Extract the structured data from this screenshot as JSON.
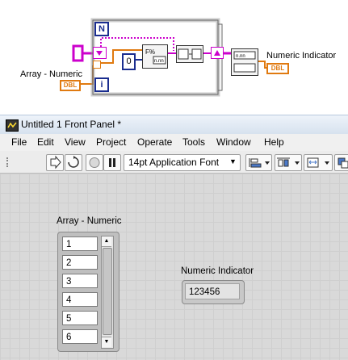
{
  "block_diagram": {
    "array_label": "Array - Numeric",
    "array_terminal": "DBL",
    "indicator_label": "Numeric Indicator",
    "indicator_terminal": "DBL",
    "n_terminal": "N",
    "i_terminal": "i",
    "constant_zero": "0"
  },
  "window": {
    "title": "Untitled 1 Front Panel *"
  },
  "menu": [
    "File",
    "Edit",
    "View",
    "Project",
    "Operate",
    "Tools",
    "Window",
    "Help"
  ],
  "toolbar": {
    "font_selector": "14pt Application Font"
  },
  "front_panel": {
    "array_label": "Array - Numeric",
    "array_values": [
      "1",
      "2",
      "3",
      "4",
      "5",
      "6"
    ],
    "indicator_label": "Numeric Indicator",
    "indicator_value": "123456"
  },
  "colors": {
    "orange_wire": "#e07a10",
    "pink_wire": "#cc00cc",
    "blue_loop": "#1a2d8f"
  }
}
